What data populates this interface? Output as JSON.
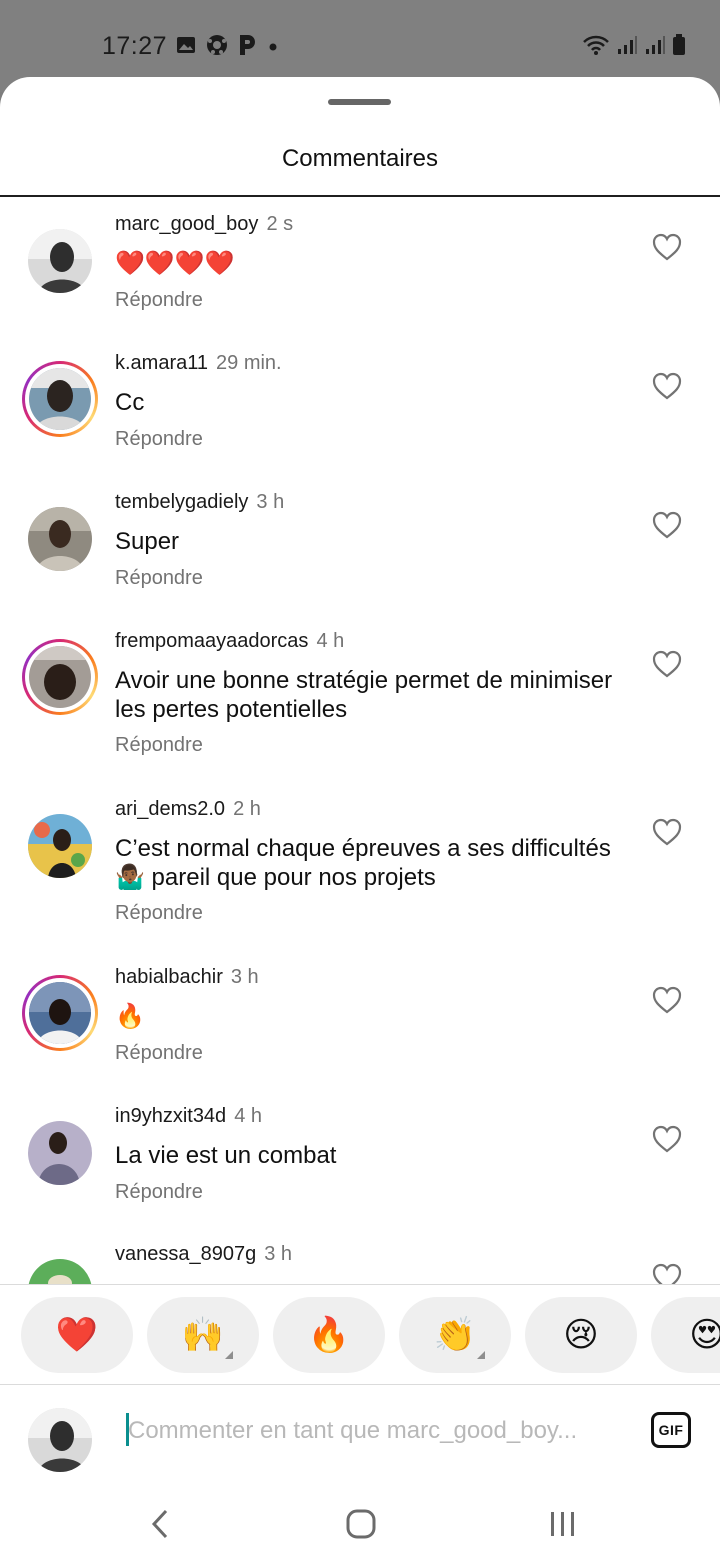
{
  "status_bar": {
    "time": "17:27"
  },
  "sheet": {
    "title": "Commentaires"
  },
  "comments": [
    {
      "user": "marc_good_boy",
      "time": "2 s",
      "text": "❤️❤️❤️❤️",
      "reply": "Répondre",
      "story_ring": false
    },
    {
      "user": "k.amara11",
      "time": "29 min.",
      "text": "Cc",
      "reply": "Répondre",
      "story_ring": true
    },
    {
      "user": "tembelygadiely",
      "time": "3 h",
      "text": "Super",
      "reply": "Répondre",
      "story_ring": false
    },
    {
      "user": "frempomaayaadorcas",
      "time": "4 h",
      "text": "Avoir une bonne stratégie permet de minimiser les pertes potentielles",
      "reply": "Répondre",
      "story_ring": true
    },
    {
      "user": "ari_dems2.0",
      "time": "2 h",
      "text": "C’est normal chaque épreuves a ses difficultés 🤷🏾‍♂️ pareil que pour nos projets",
      "reply": "Répondre",
      "story_ring": false
    },
    {
      "user": "habialbachir",
      "time": "3 h",
      "text": "🔥",
      "reply": "Répondre",
      "story_ring": true
    },
    {
      "user": "in9yhzxit34d",
      "time": "4 h",
      "text": "La vie est un combat",
      "reply": "Répondre",
      "story_ring": false
    },
    {
      "user": "vanessa_8907g",
      "time": "3 h",
      "text": "",
      "reply": "",
      "story_ring": false
    }
  ],
  "reactions": [
    {
      "emoji": "❤️",
      "has_variants": false
    },
    {
      "emoji": "🙌",
      "has_variants": true
    },
    {
      "emoji": "🔥",
      "has_variants": false
    },
    {
      "emoji": "👏",
      "has_variants": true
    },
    {
      "emoji": "😢",
      "has_variants": false
    },
    {
      "emoji": "😍",
      "has_variants": false
    }
  ],
  "composer": {
    "placeholder": "Commenter en tant que marc_good_boy...",
    "gif_label": "GIF"
  },
  "colors": {
    "story_ring_start": "#d62976",
    "story_ring_end": "#fa7e1e",
    "secondary_text": "#737373",
    "reaction_pill": "#efefef"
  }
}
